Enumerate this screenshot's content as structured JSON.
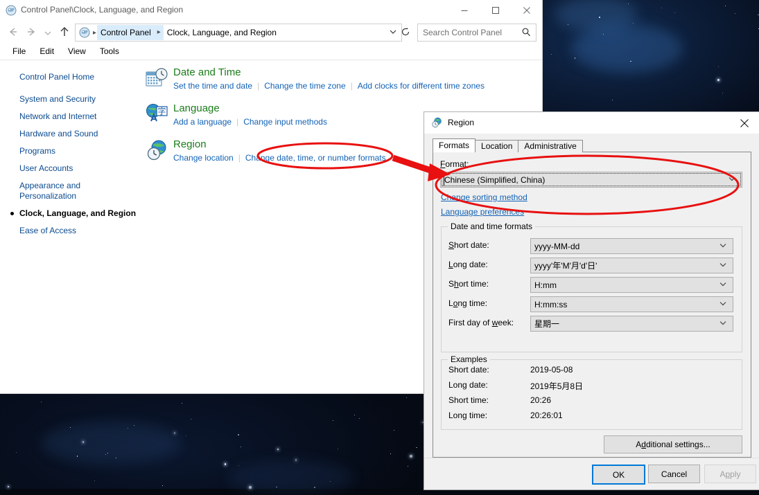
{
  "window": {
    "title": "Control Panel\\Clock, Language, and Region",
    "title_icon": "control-panel-icon",
    "minimize_label": "Minimize",
    "maximize_label": "Maximize",
    "close_label": "Close"
  },
  "nav": {
    "back_label": "Back",
    "forward_label": "Forward",
    "history_label": "Recent locations",
    "up_label": "Up",
    "breadcrumbs": [
      "Control Panel",
      "Clock, Language, and Region"
    ],
    "address_dropdown": "˅",
    "refresh_label": "Refresh"
  },
  "search": {
    "placeholder": "Search Control Panel",
    "icon": "search-icon"
  },
  "menubar": [
    "File",
    "Edit",
    "View",
    "Tools"
  ],
  "sidebar": {
    "home": "Control Panel Home",
    "items": [
      {
        "label": "System and Security",
        "current": false
      },
      {
        "label": "Network and Internet",
        "current": false
      },
      {
        "label": "Hardware and Sound",
        "current": false
      },
      {
        "label": "Programs",
        "current": false
      },
      {
        "label": "User Accounts",
        "current": false
      },
      {
        "label": "Appearance and Personalization",
        "current": false
      },
      {
        "label": "Clock, Language, and Region",
        "current": true
      },
      {
        "label": "Ease of Access",
        "current": false
      }
    ]
  },
  "categories": [
    {
      "icon": "date-and-time-icon",
      "heading": "Date and Time",
      "links": [
        "Set the time and date",
        "Change the time zone",
        "Add clocks for different time zones"
      ]
    },
    {
      "icon": "language-icon",
      "heading": "Language",
      "links": [
        "Add a language",
        "Change input methods"
      ]
    },
    {
      "icon": "region-icon",
      "heading": "Region",
      "links": [
        "Change location",
        "Change date, time, or number formats"
      ]
    }
  ],
  "dialog": {
    "title": "Region",
    "title_icon": "region-icon",
    "close_label": "Close",
    "tabs": [
      {
        "label": "Formats",
        "active": true
      },
      {
        "label": "Location",
        "active": false
      },
      {
        "label": "Administrative",
        "active": false
      }
    ],
    "format_label": "Format:",
    "format_value": "Chinese (Simplified, China)",
    "links": [
      "Change sorting method",
      "Language preferences"
    ],
    "datetime_group": {
      "title": "Date and time formats",
      "rows": [
        {
          "label": "Short date:",
          "value": "yyyy-MM-dd"
        },
        {
          "label": "Long date:",
          "value": "yyyy'年'M'月'd'日'"
        },
        {
          "label": "Short time:",
          "value": "H:mm"
        },
        {
          "label": "Long time:",
          "value": "H:mm:ss"
        },
        {
          "label": "First day of week:",
          "value": "星期一"
        }
      ]
    },
    "examples_group": {
      "title": "Examples",
      "rows": [
        {
          "label": "Short date:",
          "value": "2019-05-08"
        },
        {
          "label": "Long date:",
          "value": "2019年5月8日"
        },
        {
          "label": "Short time:",
          "value": "20:26"
        },
        {
          "label": "Long time:",
          "value": "20:26:01"
        }
      ]
    },
    "additional_settings": "Additional settings...",
    "buttons": {
      "ok": "OK",
      "cancel": "Cancel",
      "apply": "Apply"
    }
  },
  "annotations": {
    "color": "#e81010",
    "ellipse_link_label": "highlight-change-formats-link",
    "ellipse_combo_label": "highlight-format-combobox",
    "arrow_label": "pointer-arrow"
  },
  "colors": {
    "accent": "#0078d7",
    "link": "#1262b5",
    "heading_green": "#1b7c1b",
    "dialog_bg": "#f0f0f0",
    "annotation_red": "#e81010"
  }
}
